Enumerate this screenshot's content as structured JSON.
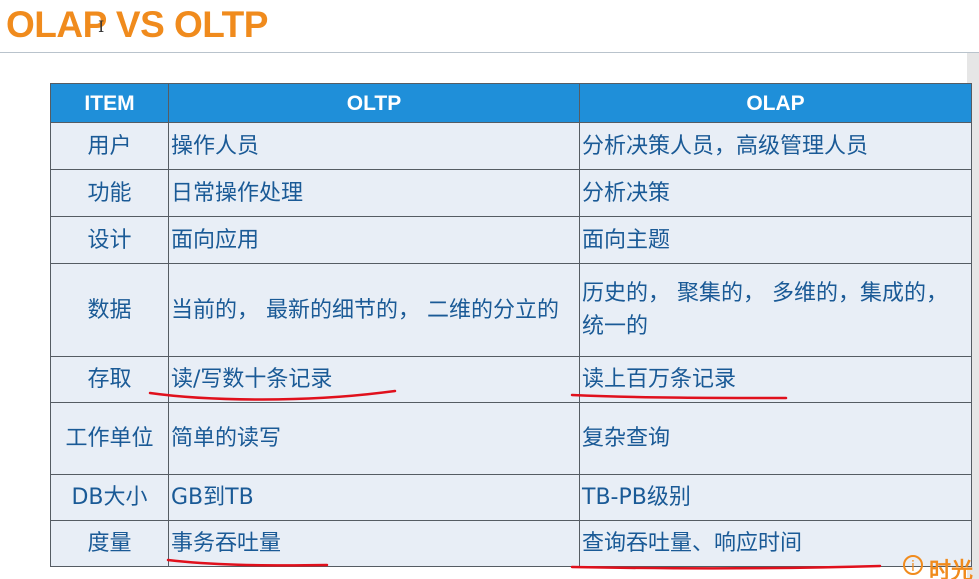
{
  "title": "OLAP VS OLTP",
  "table": {
    "headers": [
      "ITEM",
      "OLTP",
      "OLAP"
    ],
    "rows": [
      {
        "item": "用户",
        "oltp": "操作人员",
        "olap": "分析决策人员，高级管理人员"
      },
      {
        "item": "功能",
        "oltp": "日常操作处理",
        "olap": "分析决策"
      },
      {
        "item": "设计",
        "oltp": "面向应用",
        "olap": "面向主题"
      },
      {
        "item": "数据",
        "oltp": "当前的， 最新的细节的， 二维的分立的",
        "olap": "历史的， 聚集的， 多维的，集成的， 统一的"
      },
      {
        "item": "存取",
        "oltp": "读/写数十条记录",
        "olap": "读上百万条记录"
      },
      {
        "item": "工作单位",
        "oltp": "简单的读写",
        "olap": "复杂查询"
      },
      {
        "item": "DB大小",
        "oltp": "GB到TB",
        "olap": "TB-PB级别"
      },
      {
        "item": "度量",
        "oltp": "事务吞吐量",
        "olap": "查询吞吐量、响应时间"
      }
    ]
  },
  "annotations": {
    "color": "#e0101c"
  },
  "colors": {
    "title": "#f08b1d",
    "header_bg": "#1f8fd9",
    "cell_bg": "#e8eef6",
    "cell_text": "#1a5a96"
  },
  "logo": {
    "icon": "clock-logo-icon",
    "text": "时光"
  }
}
